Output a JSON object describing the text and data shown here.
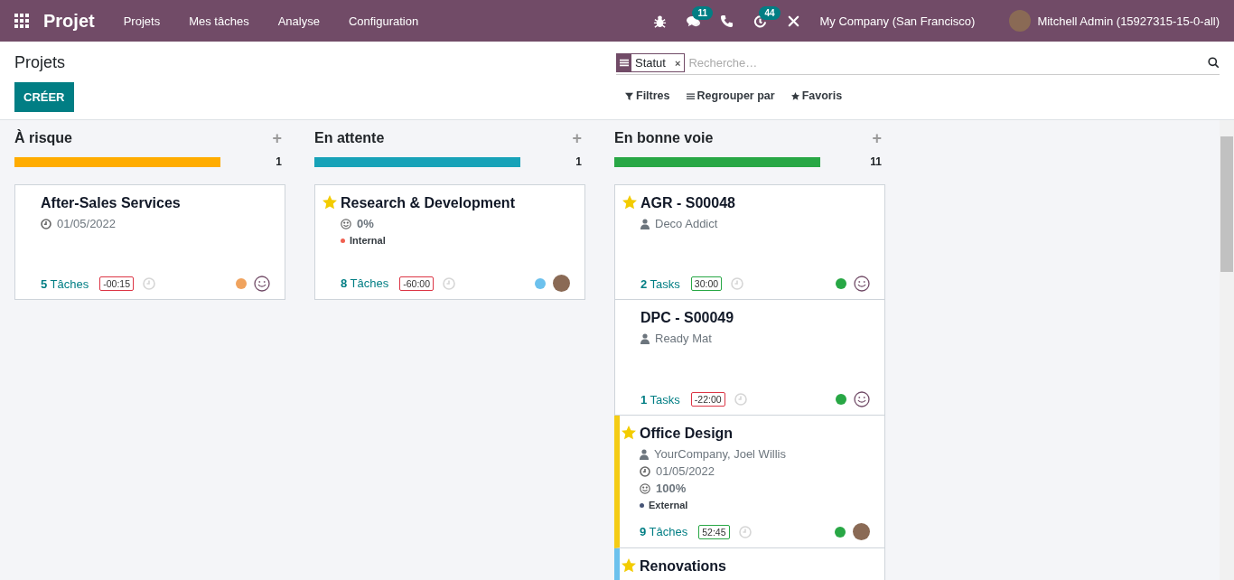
{
  "navbar": {
    "app_name": "Projet",
    "menus": [
      "Projets",
      "Mes tâches",
      "Analyse",
      "Configuration"
    ],
    "messages_badge": "11",
    "activities_badge": "44",
    "company": "My Company (San Francisco)",
    "user": "Mitchell Admin (15927315-15-0-all)"
  },
  "control_panel": {
    "breadcrumb": "Projets",
    "create_button": "CRÉER",
    "search": {
      "facet": "Statut",
      "remove": "×",
      "placeholder": "Recherche…"
    },
    "options": [
      {
        "kind": "filter",
        "label": "Filtres"
      },
      {
        "kind": "group",
        "label": "Regrouper par"
      },
      {
        "kind": "favorite",
        "label": "Favoris"
      }
    ]
  },
  "columns": [
    {
      "title": "À risque",
      "add": "+",
      "color": "#ffac00",
      "level": 1,
      "count": "1",
      "cards": [
        {
          "favorite": false,
          "title": "After-Sales Services",
          "lines": [
            {
              "kind": "date",
              "text": "01/05/2022"
            }
          ],
          "tasks": "**5** Tâches",
          "time": {
            "text": "-00:15",
            "color": "#dc3545"
          },
          "status": {
            "color": "#f0a35e"
          },
          "avatar": {
            "kind": "smiley"
          }
        }
      ]
    },
    {
      "title": "En attente",
      "add": "+",
      "color": "#17a2b8",
      "level": 1,
      "count": "1",
      "cards": [
        {
          "favorite": true,
          "title": "Research & Development",
          "lines": [
            {
              "kind": "progress",
              "text": "0%"
            },
            {
              "kind": "tag",
              "text": "Internal",
              "color": "#f06050"
            }
          ],
          "tasks": "**8** Tâches",
          "time": {
            "text": "-60:00",
            "color": "#dc3545"
          },
          "status": {
            "color": "#6cc1ed"
          },
          "avatar": {
            "kind": "photo"
          }
        }
      ]
    },
    {
      "title": "En bonne voie",
      "add": "+",
      "color": "#28a745",
      "level": 1,
      "count": "11",
      "cards": [
        {
          "favorite": true,
          "title": "AGR - S00048",
          "lines": [
            {
              "kind": "customer",
              "text": "Deco Addict"
            }
          ],
          "tasks": "**2** Tasks",
          "time": {
            "text": "30:00",
            "color": "#28a745"
          },
          "status": {
            "color": "#28a745"
          },
          "avatar": {
            "kind": "smiley"
          }
        },
        {
          "favorite": false,
          "title": "DPC - S00049",
          "lines": [
            {
              "kind": "customer",
              "text": "Ready Mat"
            }
          ],
          "tasks": "**1** Tasks",
          "time": {
            "text": "-22:00",
            "color": "#dc3545"
          },
          "status": {
            "color": "#28a745"
          },
          "avatar": {
            "kind": "smiley"
          }
        },
        {
          "favorite": true,
          "color": "#f4cc15",
          "title": "Office Design",
          "lines": [
            {
              "kind": "customer",
              "text": "YourCompany, Joel Willis"
            },
            {
              "kind": "date",
              "text": "01/05/2022"
            },
            {
              "kind": "progress",
              "text": "100%"
            },
            {
              "kind": "tag",
              "text": "External",
              "color": "#475577"
            }
          ],
          "tasks": "**9** Tâches",
          "time": {
            "text": "52:45",
            "color": "#28a745"
          },
          "status": {
            "color": "#28a745"
          },
          "avatar": {
            "kind": "photo"
          }
        },
        {
          "favorite": true,
          "color": "#6cc1ed",
          "title": "Renovations"
        }
      ]
    }
  ]
}
